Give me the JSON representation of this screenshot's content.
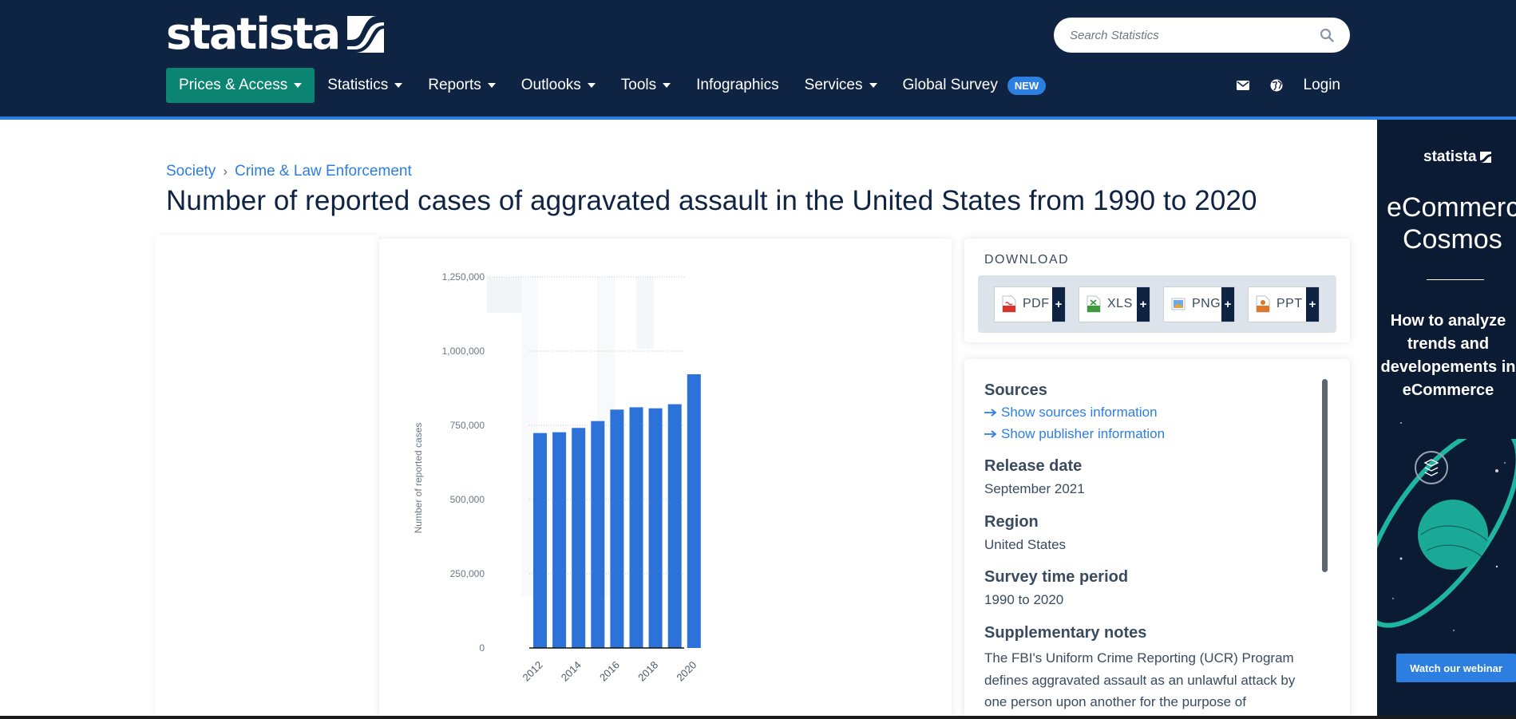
{
  "brand": {
    "logo_text": "statista",
    "accent": "#2c7ee0",
    "header_bg": "#0f2342",
    "active_nav": "#0c8472"
  },
  "search": {
    "placeholder": "Search Statistics",
    "icon": "search-icon"
  },
  "nav": {
    "items": [
      {
        "label": "Prices & Access",
        "has_caret": true
      },
      {
        "label": "Statistics",
        "has_caret": true
      },
      {
        "label": "Reports",
        "has_caret": true
      },
      {
        "label": "Outlooks",
        "has_caret": true
      },
      {
        "label": "Tools",
        "has_caret": true
      },
      {
        "label": "Infographics",
        "has_caret": false
      },
      {
        "label": "Services",
        "has_caret": true
      },
      {
        "label": "Global Survey",
        "has_caret": false
      }
    ],
    "new_badge": "NEW",
    "mail_icon": "mail-icon",
    "globe_icon": "globe-icon",
    "login": "Login"
  },
  "breadcrumb": {
    "items": [
      "Society",
      "Crime & Law Enforcement"
    ],
    "separator": "›"
  },
  "page_title": "Number of reported cases of aggravated assault in the United States from 1990 to 2020",
  "download": {
    "label": "DOWNLOAD",
    "buttons": [
      {
        "label": "PDF",
        "icon": "pdf-icon",
        "plus": "+"
      },
      {
        "label": "XLS",
        "icon": "xls-icon",
        "plus": "+"
      },
      {
        "label": "PNG",
        "icon": "png-icon",
        "plus": "+"
      },
      {
        "label": "PPT",
        "icon": "ppt-icon",
        "plus": "+"
      }
    ]
  },
  "info": {
    "sources_h": "Sources",
    "sources_link": "Show sources information",
    "publisher_link": "Show publisher information",
    "release_h": "Release date",
    "release_v": "September 2021",
    "region_h": "Region",
    "region_v": "United States",
    "period_h": "Survey time period",
    "period_v": "1990 to 2020",
    "notes_h": "Supplementary notes",
    "notes_v": "The FBI's Uniform Crime Reporting (UCR) Program defines aggravated assault as an unlawful attack by one person upon another for the purpose of"
  },
  "chart_data": {
    "type": "bar",
    "categories": [
      "2012",
      "2013",
      "2014",
      "2015",
      "2016",
      "2017",
      "2018",
      "2019",
      "2020"
    ],
    "values": [
      724000,
      726800,
      741300,
      764400,
      803000,
      810800,
      807400,
      821200,
      922000
    ],
    "x_tick_labels": [
      "2012",
      "2014",
      "2016",
      "2018",
      "2020"
    ],
    "ylabel": "Number of reported cases",
    "y_ticks": [
      "0",
      "250,000",
      "500,000",
      "750,000",
      "1,000,000",
      "1,250,000"
    ],
    "ylim": [
      0,
      1250000
    ],
    "bar_color": "#2c72d8",
    "grid": true
  },
  "ad": {
    "logo": "statista",
    "title_1": "eCommerce",
    "title_2": "Cosmos",
    "text": "How to analyze trends and developements in eCommerce",
    "cta": "Watch our webinar"
  }
}
